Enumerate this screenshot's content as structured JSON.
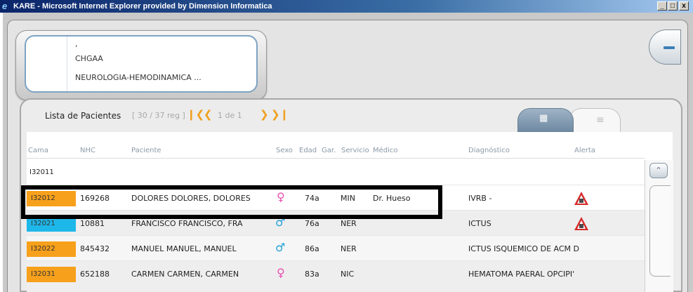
{
  "window": {
    "title": "KARE - Microsoft Internet Explorer provided by Dimension Informatica",
    "icon": "ie-icon",
    "minimize": "_",
    "maximize": "□",
    "close": "x"
  },
  "patient_info": {
    "line1": ",",
    "line2": "CHGAA",
    "line3": "NEUROLOGIA-HEMODINAMICA ..."
  },
  "panel": {
    "title": "Lista de Pacientes",
    "record_count": "[ 30 / 37  reg ]",
    "pagination": "1  de  1",
    "tabs": [
      "grid-view-icon",
      "list-view-icon"
    ]
  },
  "table": {
    "columns": [
      "Cama",
      "NHC",
      "Paciente",
      "Sexo",
      "Edad",
      "Gar.",
      "Servicio",
      "Médico",
      "Diagnóstico",
      "Alerta"
    ],
    "group_label": "I32011",
    "rows": [
      {
        "cama": "I32012",
        "bed_color": "#f7a01c",
        "nhc": "169268",
        "paciente": "DOLORES DOLORES, DOLORES",
        "sexo": "female",
        "sexo_symbol": "♀",
        "edad": "74a",
        "servicio": "MIN",
        "medico": "Dr. Hueso",
        "diagnostico": "IVRB -",
        "alerta": true
      },
      {
        "cama": "I32021",
        "bed_color": "#1eb7ea",
        "nhc": "10881",
        "paciente": "FRANCISCO FRANCISCO, FRA",
        "sexo": "male",
        "sexo_symbol": "♂",
        "edad": "76a",
        "servicio": "NER",
        "medico": "",
        "diagnostico": "ICTUS",
        "alerta": true
      },
      {
        "cama": "I32022",
        "bed_color": "#f7a01c",
        "nhc": "845432",
        "paciente": "MANUEL MANUEL, MANUEL",
        "sexo": "male",
        "sexo_symbol": "♂",
        "edad": "86a",
        "servicio": "NER",
        "medico": "",
        "diagnostico": "ICTUS ISQUEMICO DE ACM D",
        "alerta": false
      },
      {
        "cama": "I32031",
        "bed_color": "#f7a01c",
        "nhc": "652188",
        "paciente": "CARMEN CARMEN, CARMEN",
        "sexo": "female",
        "sexo_symbol": "♀",
        "edad": "83a",
        "servicio": "NIC",
        "medico": "",
        "diagnostico": "HEMATOMA PAERAL OPCIPI'",
        "alerta": false
      }
    ]
  },
  "colors": {
    "accent_orange": "#f7a01c",
    "accent_cyan": "#1eb7ea",
    "female": "#e84fb0",
    "male": "#1ea0d8",
    "alert_red": "#d62a2a"
  }
}
